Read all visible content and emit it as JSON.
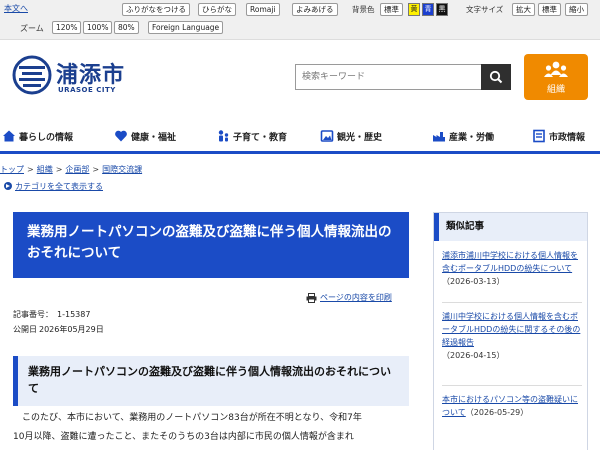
{
  "utility": {
    "skip_link": "本文へ",
    "furigana": "ふりがなをつける",
    "hiragana": "ひらがな",
    "romaji": "Romaji",
    "read_aloud": "よみあげる",
    "bg_color_label": "背景色",
    "bg_standard": "標準",
    "bg_yellow": "黄",
    "bg_blue": "青",
    "bg_black": "黒",
    "text_size_label": "文字サイズ",
    "size_large": "拡大",
    "size_standard": "標準",
    "size_small": "縮小",
    "zoom_label": "ズーム",
    "zoom_options": [
      "120%",
      "100%",
      "80%"
    ],
    "foreign_language": "Foreign Language"
  },
  "header": {
    "city_name": "浦添市",
    "city_roman": "URASOE CITY",
    "search_placeholder": "検索キーワード",
    "org_button_label": "組織"
  },
  "nav": {
    "items": [
      {
        "label": "暮らしの情報",
        "icon": "house-icon"
      },
      {
        "label": "健康・福祉",
        "icon": "health-icon"
      },
      {
        "label": "子育て・教育",
        "icon": "family-icon"
      },
      {
        "label": "観光・歴史",
        "icon": "tourism-icon"
      },
      {
        "label": "産業・労働",
        "icon": "industry-icon"
      },
      {
        "label": "市政情報",
        "icon": "city-admin-icon"
      }
    ]
  },
  "breadcrumb": {
    "items": [
      "トップ",
      "組織",
      "企画部",
      "国際交流課"
    ],
    "separator": ">",
    "show_all": "カテゴリを全て表示する"
  },
  "article": {
    "title": "業務用ノートパソコンの盗難及び盗難に伴う個人情報流出のおそれについて",
    "print_label": "ページの内容を印刷",
    "article_no_label": "記事番号：",
    "article_no": "1-15387",
    "published_label": "公開日",
    "published_date": "2026年05月29日",
    "sub_heading": "業務用ノートパソコンの盗難及び盗難に伴う個人情報流出のおそれについて",
    "body_line1": "このたび、本市において、業務用のノートパソコン83台が所在不明となり、令和7年",
    "body_line2": "10月以降、盗難に遭ったこと、またそのうちの3台は内部に市民の個人情報が含まれ"
  },
  "sidebar": {
    "heading": "類似記事",
    "items": [
      {
        "title": "浦添市浦川中学校における個人情報を含むポータブルHDDの紛失について",
        "date": "（2026-03-13）"
      },
      {
        "title": "浦川中学校における個人情報を含むポータブルHDDの紛失に関するその後の経過報告",
        "date": "（2026-04-15）"
      },
      {
        "title": "本市におけるパソコン等の盗難疑いについて",
        "date": "（2026-05-29）"
      }
    ]
  },
  "colors": {
    "brand_blue": "#1b4cc6",
    "org_orange": "#f08a00",
    "link_blue": "#1a4aa8"
  }
}
